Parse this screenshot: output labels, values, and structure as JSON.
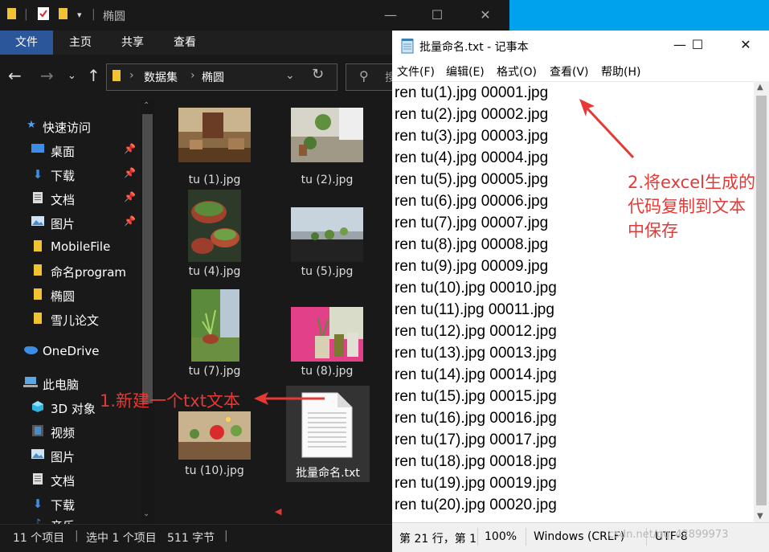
{
  "explorer": {
    "window_title": "椭圆",
    "ribbon_tabs": [
      "文件",
      "主页",
      "共享",
      "查看"
    ],
    "breadcrumb": [
      "数据集",
      "椭圆"
    ],
    "search_placeholder": "搜",
    "sidebar": [
      {
        "label": "快速访问",
        "icon": "star-icon"
      },
      {
        "label": "桌面",
        "icon": "desktop-icon",
        "pinned": true
      },
      {
        "label": "下载",
        "icon": "download-icon",
        "pinned": true
      },
      {
        "label": "文档",
        "icon": "document-icon",
        "pinned": true
      },
      {
        "label": "图片",
        "icon": "pictures-icon",
        "pinned": true
      },
      {
        "label": "MobileFile",
        "icon": "folder-icon"
      },
      {
        "label": "命名program",
        "icon": "folder-icon"
      },
      {
        "label": "椭圆",
        "icon": "folder-icon"
      },
      {
        "label": "雪儿论文",
        "icon": "folder-icon"
      },
      {
        "label": "OneDrive",
        "icon": "cloud-icon"
      },
      {
        "label": "此电脑",
        "icon": "computer-icon"
      },
      {
        "label": "3D 对象",
        "icon": "cube-icon"
      },
      {
        "label": "视频",
        "icon": "video-icon"
      },
      {
        "label": "图片",
        "icon": "pictures-icon"
      },
      {
        "label": "文档",
        "icon": "document-icon"
      },
      {
        "label": "下载",
        "icon": "download-icon"
      },
      {
        "label": "音乐",
        "icon": "music-icon"
      }
    ],
    "files": [
      {
        "name": "tu (1).jpg"
      },
      {
        "name": "tu (2).jpg"
      },
      {
        "name": "tu (4).jpg"
      },
      {
        "name": "tu (5).jpg"
      },
      {
        "name": "tu (7).jpg"
      },
      {
        "name": "tu (8).jpg"
      },
      {
        "name": "tu (10).jpg"
      },
      {
        "name": "批量命名.txt"
      }
    ],
    "status": {
      "count": "11 个项目",
      "selected": "选中 1 个项目",
      "size": "511 字节"
    }
  },
  "notepad": {
    "title": "批量命名.txt - 记事本",
    "menu": [
      "文件(F)",
      "编辑(E)",
      "格式(O)",
      "查看(V)",
      "帮助(H)"
    ],
    "lines": [
      "ren tu(1).jpg 00001.jpg",
      "ren tu(2).jpg 00002.jpg",
      "ren tu(3).jpg 00003.jpg",
      "ren tu(4).jpg 00004.jpg",
      "ren tu(5).jpg 00005.jpg",
      "ren tu(6).jpg 00006.jpg",
      "ren tu(7).jpg 00007.jpg",
      "ren tu(8).jpg 00008.jpg",
      "ren tu(9).jpg 00009.jpg",
      "ren tu(10).jpg 00010.jpg",
      "ren tu(11).jpg 00011.jpg",
      "ren tu(12).jpg 00012.jpg",
      "ren tu(13).jpg 00013.jpg",
      "ren tu(14).jpg 00014.jpg",
      "ren tu(15).jpg 00015.jpg",
      "ren tu(16).jpg 00016.jpg",
      "ren tu(17).jpg 00017.jpg",
      "ren tu(18).jpg 00018.jpg",
      "ren tu(19).jpg 00019.jpg",
      "ren tu(20).jpg 00020.jpg"
    ],
    "status": {
      "position": "第 21 行，第 1",
      "zoom": "100%",
      "eol": "Windows (CRLF)",
      "encoding": "UTF-8"
    }
  },
  "annotations": {
    "step1": "1.新建一个txt文本",
    "step2_lines": [
      "2.将excel生成的",
      "代码复制到文本",
      "中保存"
    ],
    "color": "#e53935"
  },
  "watermark": "csdn.net/qq_42899973"
}
